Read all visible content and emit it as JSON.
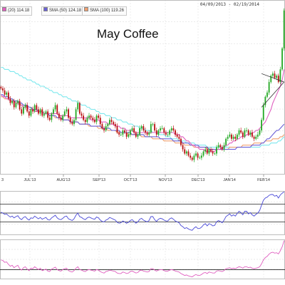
{
  "header": {
    "date_range": "04/09/2013 - 02/19/2014",
    "legend": [
      {
        "label": "(20) 114.18",
        "color": "#e060c0"
      },
      {
        "label": "SMA (50) 124.18",
        "color": "#6a60d8"
      },
      {
        "label": "SMA (100) 119.26",
        "color": "#f0a070"
      }
    ]
  },
  "chart_data": [
    {
      "type": "candlestick",
      "title": "May Coffee",
      "x_tick_labels": [
        "JUL'13",
        "AUG'13",
        "SEP'13",
        "OCT'13",
        "NOV'13",
        "DEC'13",
        "JAN'14",
        "FEB'14"
      ],
      "x_tick_partial_left": "3",
      "grid": true,
      "closes": [
        141,
        140,
        138,
        139,
        136,
        134,
        135,
        132,
        134,
        135,
        131,
        129,
        132,
        133,
        130,
        128,
        131,
        130,
        133,
        131,
        129,
        131,
        128,
        129,
        130,
        127,
        126,
        129,
        131,
        133,
        129,
        127,
        126,
        128,
        130,
        131,
        127,
        125,
        124,
        126,
        131,
        134,
        129,
        128,
        126,
        125,
        127,
        128,
        127,
        126,
        125,
        128,
        127,
        124,
        122,
        121,
        123,
        124,
        126,
        125,
        124,
        123,
        120,
        119,
        119,
        121,
        120,
        118,
        119,
        121,
        122,
        120,
        118,
        119,
        122,
        123,
        121,
        120,
        119,
        120,
        124,
        124,
        121,
        119,
        121,
        122,
        122,
        120,
        119,
        119,
        121,
        122,
        121,
        119,
        118,
        117,
        114,
        112,
        110,
        111,
        109,
        108,
        107,
        109,
        110,
        108,
        108,
        109,
        111,
        112,
        110,
        112,
        111,
        110,
        110,
        113,
        114,
        113,
        112,
        114,
        117,
        118,
        119,
        117,
        118,
        117,
        119,
        121,
        120,
        118,
        121,
        121,
        119,
        120,
        118,
        117,
        118,
        119,
        121,
        126,
        133,
        137,
        139,
        144,
        147,
        148,
        146,
        147,
        144,
        150,
        160,
        178
      ],
      "series": [
        {
          "name": "",
          "values": [
            151,
            151,
            150,
            150,
            150,
            149,
            149,
            149,
            148,
            148,
            147,
            147,
            146,
            146,
            145,
            145,
            145,
            144,
            144,
            143,
            143,
            142,
            142,
            142,
            141,
            141,
            140,
            140,
            139,
            139,
            139,
            138,
            138,
            137,
            137,
            137,
            136,
            136,
            135,
            135,
            135,
            134,
            134,
            133,
            133,
            133,
            132,
            132,
            131,
            131,
            131,
            130,
            130,
            129,
            129,
            129,
            128,
            128,
            128,
            127,
            127,
            127,
            126,
            126,
            126,
            125,
            125,
            125,
            124,
            124,
            124,
            123,
            123,
            123,
            122,
            122,
            122,
            121,
            121,
            121,
            121,
            120,
            120,
            120,
            119,
            119,
            119,
            119,
            118,
            118,
            118,
            117,
            117,
            117,
            117,
            116,
            116,
            116,
            116,
            115,
            115,
            115,
            115,
            115,
            114,
            114,
            114,
            114,
            114,
            114,
            113,
            113,
            113,
            113,
            113,
            113,
            113,
            113,
            113,
            113,
            113,
            113,
            113,
            113,
            113,
            113,
            113,
            113,
            113,
            113,
            113,
            113,
            113,
            113,
            113,
            113,
            113,
            113,
            113,
            114,
            114,
            114,
            114,
            114,
            115,
            115,
            115,
            115,
            116,
            116,
            117,
            118
          ]
        },
        {
          "name": "",
          "values": [
            137,
            137,
            136,
            136,
            136,
            135,
            135,
            135,
            134,
            134,
            134,
            133,
            133,
            133,
            132,
            132,
            132,
            131,
            131,
            131,
            130,
            130,
            130,
            129,
            129,
            129,
            128,
            128,
            128,
            127,
            127,
            127,
            127,
            126,
            126,
            126,
            126,
            125,
            125,
            125,
            125,
            125,
            124,
            124,
            124,
            124,
            124,
            123,
            123,
            123,
            123,
            123,
            122,
            122,
            122,
            122,
            122,
            121,
            121,
            121,
            121,
            121,
            120,
            120,
            120,
            120,
            120,
            120,
            119,
            119,
            119,
            119,
            119,
            119,
            119,
            118,
            118,
            118,
            118,
            118,
            118,
            117,
            117,
            117,
            117,
            117,
            117,
            116,
            116,
            116,
            116,
            116,
            116,
            115,
            115,
            115,
            115,
            115,
            114,
            114,
            114,
            114,
            114,
            113,
            113,
            113,
            113,
            113,
            113,
            113,
            112,
            112,
            112,
            112,
            112,
            112,
            112,
            112,
            112,
            112,
            112,
            112,
            113,
            113,
            113,
            113,
            113,
            113,
            113,
            114,
            114,
            114,
            114,
            114,
            114,
            115,
            115,
            115,
            115,
            115,
            115,
            116,
            116,
            116,
            116,
            117,
            117,
            117,
            117,
            118,
            118,
            119
          ]
        },
        {
          "name": "",
          "values": [
            138,
            138,
            137,
            137,
            137,
            136,
            136,
            135,
            135,
            135,
            134,
            134,
            133,
            133,
            133,
            132,
            132,
            131,
            131,
            131,
            130,
            130,
            130,
            129,
            129,
            129,
            128,
            128,
            128,
            128,
            127,
            127,
            127,
            126,
            126,
            126,
            126,
            125,
            125,
            125,
            125,
            125,
            124,
            124,
            124,
            124,
            124,
            124,
            123,
            123,
            123,
            123,
            123,
            123,
            122,
            122,
            122,
            122,
            122,
            121,
            121,
            121,
            121,
            121,
            120,
            120,
            120,
            120,
            120,
            120,
            119,
            119,
            119,
            119,
            119,
            119,
            119,
            118,
            118,
            118,
            118,
            118,
            118,
            118,
            118,
            117,
            117,
            117,
            117,
            117,
            117,
            117,
            116,
            116,
            116,
            116,
            116,
            115,
            115,
            115,
            115,
            114,
            114,
            114,
            114,
            114,
            113,
            113,
            113,
            113,
            113,
            112,
            112,
            112,
            112,
            112,
            112,
            112,
            112,
            112,
            112,
            112,
            112,
            112,
            112,
            112,
            113,
            113,
            113,
            113,
            113,
            113,
            113,
            113,
            114,
            114,
            114,
            114,
            114,
            115,
            115,
            116,
            117,
            117,
            118,
            119,
            120,
            121,
            121,
            122,
            123,
            124
          ]
        },
        {
          "name": "",
          "values": [
            138,
            137,
            137,
            136,
            136,
            135,
            135,
            135,
            134,
            134,
            133,
            133,
            132,
            132,
            132,
            131,
            131,
            131,
            130,
            130,
            130,
            130,
            130,
            129,
            129,
            129,
            129,
            129,
            129,
            129,
            129,
            128,
            128,
            128,
            128,
            128,
            128,
            127,
            127,
            127,
            127,
            127,
            127,
            127,
            127,
            127,
            127,
            127,
            126,
            126,
            126,
            126,
            126,
            125,
            125,
            125,
            125,
            124,
            124,
            124,
            124,
            123,
            123,
            123,
            122,
            122,
            122,
            121,
            121,
            121,
            121,
            120,
            120,
            120,
            120,
            120,
            120,
            120,
            120,
            120,
            120,
            120,
            120,
            120,
            120,
            120,
            120,
            120,
            120,
            120,
            120,
            120,
            120,
            119,
            119,
            119,
            118,
            118,
            117,
            116,
            116,
            115,
            114,
            114,
            113,
            113,
            112,
            112,
            112,
            111,
            111,
            111,
            111,
            111,
            111,
            112,
            112,
            112,
            113,
            113,
            114,
            114,
            115,
            115,
            116,
            116,
            117,
            117,
            118,
            118,
            118,
            119,
            119,
            119,
            120,
            120,
            121,
            121,
            122,
            123,
            124,
            125,
            127,
            129,
            131,
            134,
            136,
            138,
            140,
            142,
            145,
            150
          ]
        }
      ]
    },
    {
      "type": "line",
      "panel": "oscillator-1",
      "grid": true,
      "reference_lines": [
        70,
        50,
        30
      ],
      "series": [
        {
          "name": "",
          "values": [
            52,
            50,
            47,
            48,
            44,
            41,
            43,
            39,
            42,
            44,
            38,
            35,
            40,
            42,
            37,
            34,
            39,
            38,
            43,
            40,
            37,
            40,
            36,
            38,
            40,
            35,
            34,
            39,
            42,
            45,
            39,
            36,
            35,
            38,
            42,
            43,
            37,
            35,
            33,
            37,
            45,
            50,
            42,
            40,
            37,
            35,
            39,
            41,
            39,
            37,
            36,
            41,
            39,
            34,
            31,
            30,
            34,
            36,
            40,
            38,
            36,
            34,
            29,
            27,
            28,
            32,
            30,
            27,
            29,
            33,
            35,
            31,
            27,
            30,
            36,
            38,
            34,
            32,
            30,
            33,
            42,
            42,
            35,
            31,
            36,
            38,
            37,
            34,
            32,
            32,
            37,
            39,
            36,
            32,
            30,
            28,
            22,
            19,
            15,
            17,
            14,
            12,
            11,
            16,
            19,
            15,
            15,
            18,
            23,
            26,
            21,
            26,
            24,
            21,
            22,
            30,
            33,
            31,
            28,
            34,
            42,
            45,
            48,
            43,
            46,
            43,
            49,
            54,
            51,
            46,
            54,
            54,
            48,
            51,
            46,
            43,
            47,
            50,
            56,
            68,
            79,
            84,
            86,
            90,
            92,
            92,
            88,
            90,
            84,
            91,
            95,
            98
          ]
        }
      ]
    },
    {
      "type": "line",
      "panel": "oscillator-2",
      "grid": true,
      "reference_lines": [
        0
      ],
      "series": [
        {
          "name": "",
          "values": [
            40,
            38,
            30,
            32,
            22,
            14,
            18,
            8,
            14,
            18,
            4,
            -2,
            8,
            12,
            2,
            -4,
            6,
            4,
            12,
            6,
            0,
            6,
            -4,
            -1,
            2,
            -6,
            -8,
            2,
            6,
            10,
            0,
            -4,
            -6,
            0,
            4,
            6,
            -4,
            -8,
            -10,
            -4,
            6,
            12,
            0,
            -2,
            -6,
            -8,
            -2,
            0,
            -2,
            -4,
            -6,
            0,
            -2,
            -8,
            -12,
            -14,
            -8,
            -6,
            -2,
            -4,
            -6,
            -8,
            -14,
            -16,
            -16,
            -10,
            -12,
            -16,
            -14,
            -8,
            -6,
            -10,
            -14,
            -12,
            -4,
            -2,
            -6,
            -8,
            -10,
            -8,
            4,
            4,
            -2,
            -6,
            -2,
            0,
            0,
            -4,
            -6,
            -6,
            -2,
            0,
            -2,
            -6,
            -8,
            -10,
            -16,
            -20,
            -24,
            -22,
            -26,
            -28,
            -30,
            -24,
            -20,
            -24,
            -24,
            -20,
            -14,
            -12,
            -16,
            -10,
            -12,
            -14,
            -14,
            -6,
            -4,
            -6,
            -8,
            -4,
            4,
            6,
            8,
            4,
            6,
            4,
            8,
            12,
            10,
            6,
            12,
            12,
            8,
            10,
            6,
            4,
            6,
            8,
            12,
            24,
            40,
            50,
            55,
            64,
            70,
            72,
            68,
            70,
            65,
            78,
            95,
            120
          ]
        }
      ]
    }
  ]
}
